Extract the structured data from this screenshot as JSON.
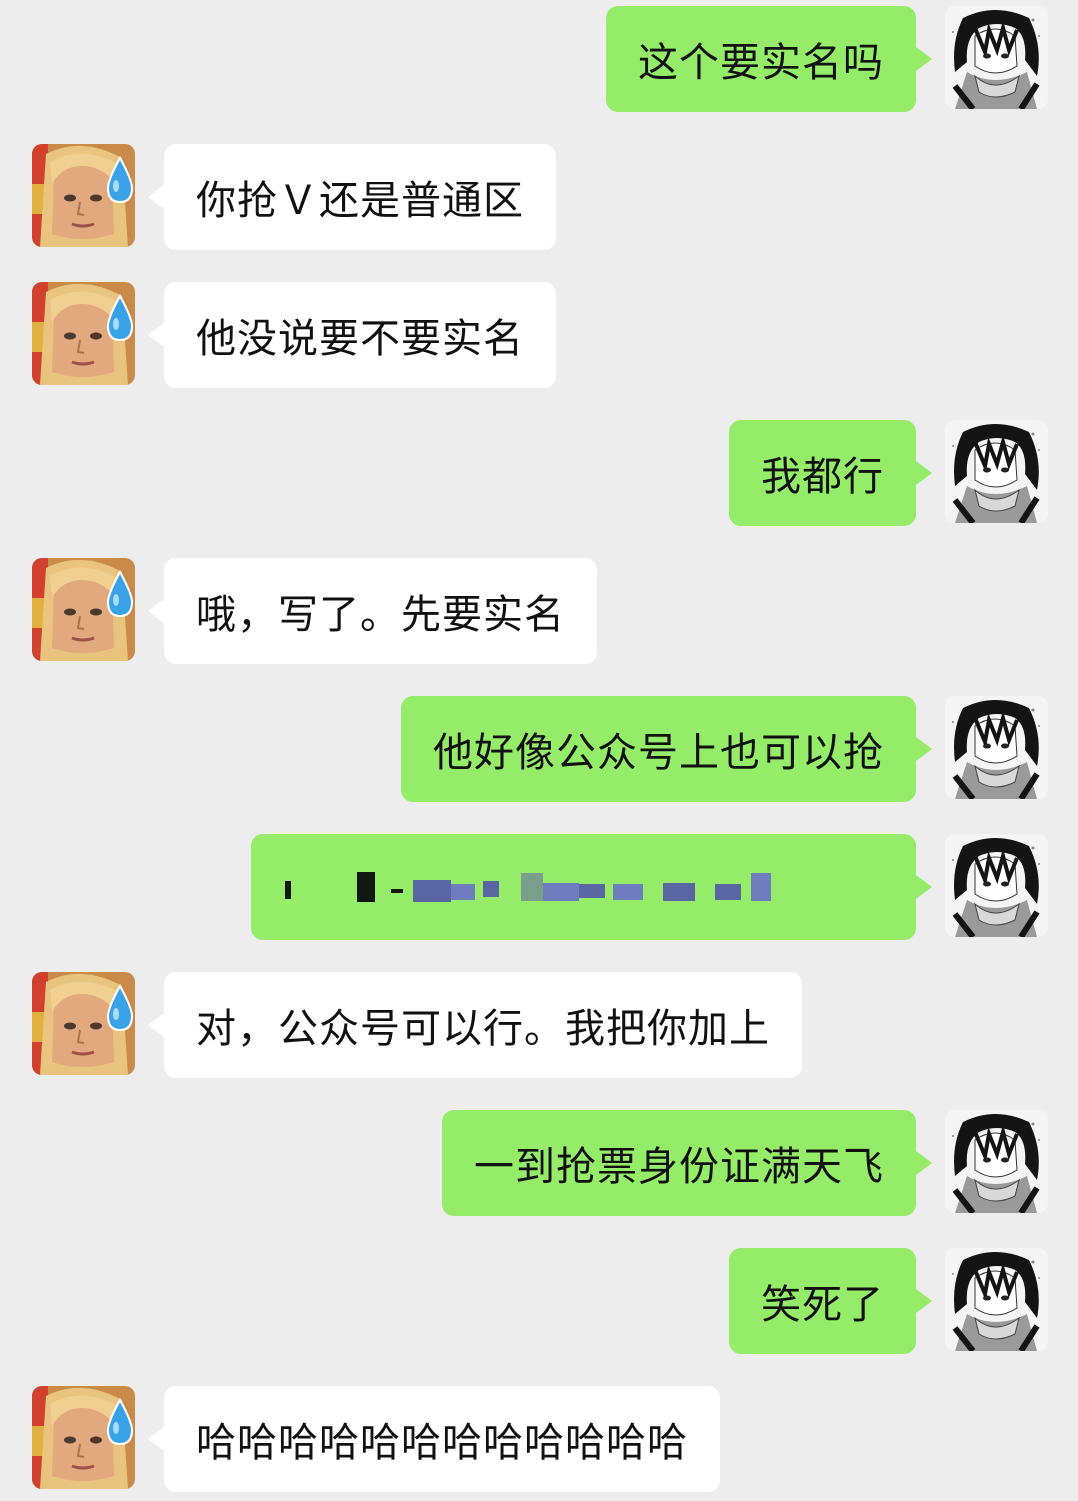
{
  "conversation": {
    "messages": [
      {
        "sender": "me",
        "text": "这个要实名吗"
      },
      {
        "sender": "friend",
        "text": "你抢Ｖ还是普通区"
      },
      {
        "sender": "friend",
        "text": "他没说要不要实名"
      },
      {
        "sender": "me",
        "text": "我都行"
      },
      {
        "sender": "friend",
        "text": "哦，写了。先要实名"
      },
      {
        "sender": "me",
        "text": "他好像公众号上也可以抢"
      },
      {
        "sender": "me",
        "text": "",
        "redacted": true
      },
      {
        "sender": "friend",
        "text": "对，公众号可以行。我把你加上"
      },
      {
        "sender": "me",
        "text": "一到抢票身份证满天飞"
      },
      {
        "sender": "me",
        "text": "笑死了"
      },
      {
        "sender": "friend",
        "text": "哈哈哈哈哈哈哈哈哈哈哈哈"
      }
    ]
  },
  "colors": {
    "background": "#ededed",
    "my_bubble": "#95ec69",
    "friend_bubble": "#ffffff"
  },
  "icons": {
    "my_avatar": "anime-portrait-avatar",
    "friend_avatar": "doll-with-sweat-drop-avatar"
  }
}
